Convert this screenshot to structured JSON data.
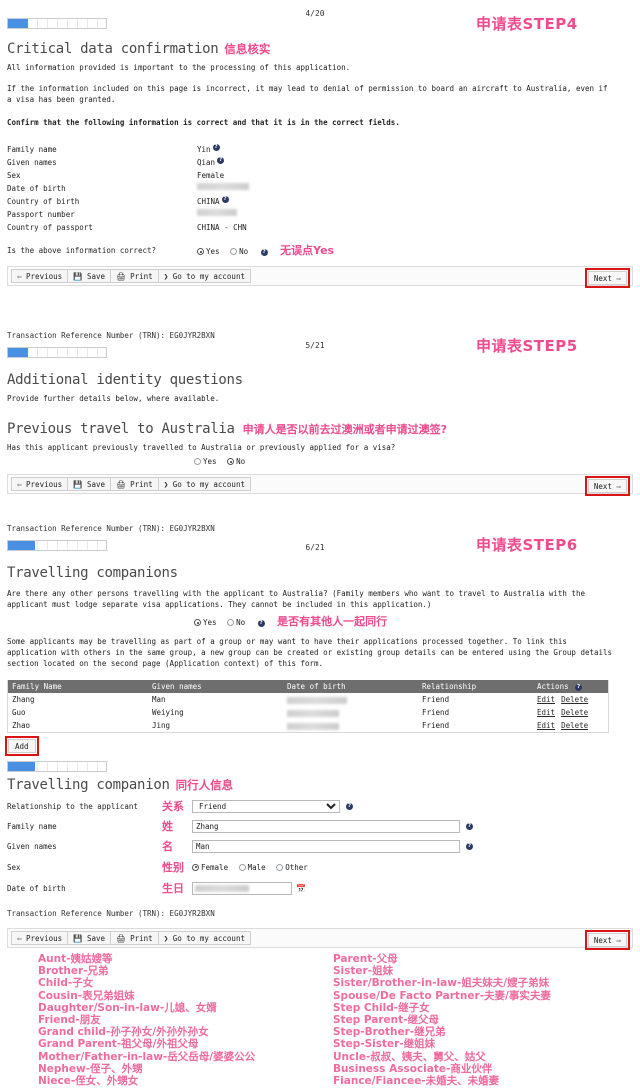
{
  "steps": [
    {
      "id": "step4",
      "page_number": "4/20",
      "step_label": "申请表STEP4",
      "progress_percent": 20,
      "heading": "Critical data confirmation",
      "heading_cn": "信息核实",
      "paragraphs": [
        "All information provided is important to the processing of this application.",
        "If the information included on this page is incorrect, it may lead to denial of permission to board an aircraft to Australia, even if a visa has been granted.",
        "Confirm that the following information is correct and that it is in the correct fields."
      ],
      "fields": [
        {
          "label": "Family name",
          "value": "Yin",
          "help": true,
          "redacted": false
        },
        {
          "label": "Given names",
          "value": "Qian",
          "help": true,
          "redacted": false
        },
        {
          "label": "Sex",
          "value": "Female",
          "help": false,
          "redacted": false
        },
        {
          "label": "Date of birth",
          "value": "",
          "help": false,
          "redacted": true,
          "redact_width": 52
        },
        {
          "label": "Country of birth",
          "value": "CHINA",
          "help": true,
          "redacted": false
        },
        {
          "label": "Passport number",
          "value": "",
          "help": false,
          "redacted": true,
          "redact_width": 40
        },
        {
          "label": "Country of passport",
          "value": "CHINA - CHN",
          "help": false,
          "redacted": false
        }
      ],
      "question": "Is the above information correct?",
      "options": [
        "Yes",
        "No"
      ],
      "selected": "Yes",
      "question_note_cn": "无误点Yes"
    },
    {
      "id": "step5",
      "trn_label": "Transaction Reference Number (TRN): EG0JYR2BXN",
      "page_number": "5/21",
      "step_label": "申请表STEP5",
      "progress_percent": 20,
      "heading": "Additional identity questions",
      "subtext": "Provide further details below, where available.",
      "subheading": "Previous travel to Australia",
      "subheading_cn": "申请人是否以前去过澳洲或者申请过澳签?",
      "question": "Has this applicant previously travelled to Australia or previously applied for a visa?",
      "options": [
        "Yes",
        "No"
      ],
      "selected": "No"
    },
    {
      "id": "step6",
      "trn_label": "Transaction Reference Number (TRN): EG0JYR2BXN",
      "page_number": "6/21",
      "step_label": "申请表STEP6",
      "progress_percent": 28,
      "heading": "Travelling companions",
      "question": "Are there any other persons travelling with the applicant to Australia? (Family members who want to travel to Australia with the applicant must lodge separate visa applications. They cannot be included in this application.)",
      "options": [
        "Yes",
        "No"
      ],
      "selected": "Yes",
      "question_note_cn": "是否有其他人一起同行",
      "group_note": "Some applicants may be travelling as part of a group or may want to have their applications processed together. To link this application with others in the same group, a new group can be created or existing group details can be entered using the Group details section located on the second page (Application context) of this form.",
      "table": {
        "columns": [
          "Family Name",
          "Given names",
          "Date of birth",
          "Relationship",
          "Actions"
        ],
        "rows": [
          {
            "family": "Zhang",
            "given": "Man",
            "dob": "",
            "relationship": "Friend",
            "actions": [
              "Edit",
              "Delete"
            ]
          },
          {
            "family": "Guo",
            "given": "Weiying",
            "dob": "",
            "relationship": "Friend",
            "actions": [
              "Edit",
              "Delete"
            ]
          },
          {
            "family": "Zhao",
            "given": "Jing",
            "dob": "",
            "relationship": "Friend",
            "actions": [
              "Edit",
              "Delete"
            ]
          }
        ]
      },
      "add_label": "Add",
      "sub_progress_percent": 28,
      "companion_heading": "Travelling companion",
      "companion_heading_cn": "同行人信息",
      "companion_form": {
        "relationship_label": "Relationship to the applicant",
        "relationship_cn": "关系",
        "relationship_value": "Friend",
        "relationship_options": [
          "Friend"
        ],
        "family_label": "Family name",
        "family_cn": "姓",
        "family_value": "Zhang",
        "given_label": "Given names",
        "given_cn": "名",
        "given_value": "Man",
        "sex_label": "Sex",
        "sex_cn": "性别",
        "sex_options": [
          "Female",
          "Male",
          "Other"
        ],
        "sex_selected": "Female",
        "dob_label": "Date of birth",
        "dob_cn": "生日",
        "dob_value": ""
      },
      "trn_label_bottom": "Transaction Reference Number (TRN): EG0JYR2BXN"
    }
  ],
  "toolbar": {
    "previous_label": "Previous",
    "save_label": "Save",
    "print_label": "Print",
    "account_label": "Go to my account",
    "next_label": "Next"
  },
  "glossary": {
    "left": [
      "Aunt-姨姑嫂等",
      "Brother-兄弟",
      "Child-子女",
      "Cousin-表兄弟姐妹",
      "Daughter/Son-in-law-儿媳、女婿",
      "Friend-朋友",
      "Grand child-孙子孙女/外孙外孙女",
      "Grand Parent-祖父母/外祖父母",
      "Mother/Father-in-law-岳父岳母/婆婆公公",
      "Nephew-侄子、外甥",
      "Niece-侄女、外甥女"
    ],
    "right": [
      "Parent-父母",
      "Sister-姐妹",
      "Sister/Brother-in-law-姐夫妹夫/嫂子弟妹",
      "Spouse/De Facto Partner-夫妻/事实夫妻",
      "Step Child-继子女",
      "Step Parent-继父母",
      "Step-Brother-继兄弟",
      "Step-Sister-继姐妹",
      "Uncle-叔叔、姨夫、舅父、姑父",
      "Business Associate-商业伙伴",
      "Fiance/Fiancee-未婚夫、未婚妻"
    ]
  },
  "colors": {
    "accent_pink": "#ef4b8f",
    "progress_blue": "#4a90e2",
    "highlight_red": "#d81414",
    "table_header": "#6e6e6e"
  }
}
